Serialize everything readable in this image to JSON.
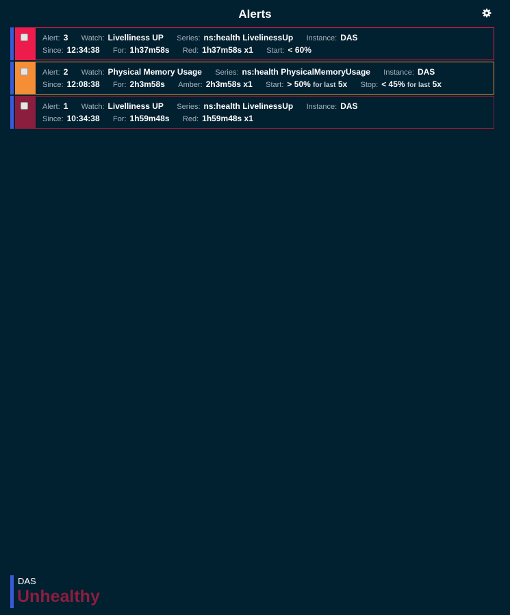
{
  "header": {
    "title": "Alerts",
    "settings_icon": "gear-icon"
  },
  "labels": {
    "alert": "Alert:",
    "watch": "Watch:",
    "series": "Series:",
    "instance": "Instance:",
    "since": "Since:",
    "for": "For:",
    "red": "Red:",
    "amber": "Amber:",
    "start": "Start:",
    "stop": "Stop:"
  },
  "colors": {
    "background": "#012030",
    "edge": "#3a5bd9",
    "red": "#ee1c4c",
    "amber": "#f68e35",
    "dark_red": "#8b1e3f"
  },
  "alerts": [
    {
      "id": "3",
      "watch": "Livelliness UP",
      "series": "ns:health LivelinessUp",
      "instance": "DAS",
      "since": "12:34:38",
      "for": "1h37m58s",
      "red": "1h37m58s x1",
      "start": "< 60%"
    },
    {
      "id": "2",
      "watch": "Physical Memory Usage",
      "series": "ns:health PhysicalMemoryUsage",
      "instance": "DAS",
      "since": "12:08:38",
      "for": "2h3m58s",
      "amber": "2h3m58s x1",
      "start": "> 50%",
      "start_for_last": "for last",
      "start_count": "5x",
      "stop": "< 45%",
      "stop_for_last": "for last",
      "stop_count": "5x"
    },
    {
      "id": "1",
      "watch": "Livelliness UP",
      "series": "ns:health LivelinessUp",
      "instance": "DAS",
      "since": "10:34:38",
      "for": "1h59m48s",
      "red": "1h59m48s x1"
    }
  ],
  "footer": {
    "instance": "DAS",
    "status": "Unhealthy"
  }
}
